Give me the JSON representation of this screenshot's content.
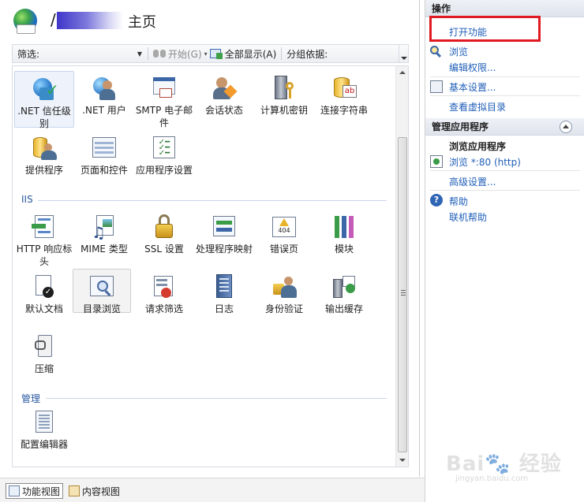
{
  "header": {
    "title_prefix": "/",
    "title": "主页"
  },
  "toolbar": {
    "filter_label": "筛选:",
    "filter_value": "",
    "start_label": "开始(G)",
    "show_all_label": "全部显示(A)",
    "group_by_label": "分组依据:"
  },
  "features": {
    "top": [
      {
        "label": ".NET 信任级别",
        "icon": "dotnet-trust-icon"
      },
      {
        "label": ".NET 用户",
        "icon": "dotnet-users-icon"
      },
      {
        "label": "SMTP 电子邮件",
        "icon": "smtp-email-icon"
      },
      {
        "label": "会话状态",
        "icon": "session-state-icon"
      },
      {
        "label": "计算机密钥",
        "icon": "machine-key-icon"
      },
      {
        "label": "连接字符串",
        "icon": "connection-strings-icon"
      },
      {
        "label": "提供程序",
        "icon": "providers-icon"
      },
      {
        "label": "页面和控件",
        "icon": "pages-controls-icon"
      },
      {
        "label": "应用程序设置",
        "icon": "app-settings-icon"
      }
    ],
    "iis_section": "IIS",
    "iis": [
      {
        "label": "HTTP 响应标头",
        "icon": "http-headers-icon"
      },
      {
        "label": "MIME 类型",
        "icon": "mime-types-icon"
      },
      {
        "label": "SSL 设置",
        "icon": "ssl-lock-icon"
      },
      {
        "label": "处理程序映射",
        "icon": "handler-mappings-icon"
      },
      {
        "label": "错误页",
        "icon": "error-pages-icon"
      },
      {
        "label": "模块",
        "icon": "modules-icon"
      },
      {
        "label": "默认文档",
        "icon": "default-document-icon"
      },
      {
        "label": "目录浏览",
        "icon": "directory-browsing-icon"
      },
      {
        "label": "请求筛选",
        "icon": "request-filtering-icon"
      },
      {
        "label": "日志",
        "icon": "logging-icon"
      },
      {
        "label": "身份验证",
        "icon": "authentication-icon"
      },
      {
        "label": "输出缓存",
        "icon": "output-caching-icon"
      },
      {
        "label": "压缩",
        "icon": "compression-icon"
      }
    ],
    "manage_section": "管理",
    "manage": [
      {
        "label": "配置编辑器",
        "icon": "config-editor-icon"
      }
    ]
  },
  "bottom_tabs": {
    "features_view": "功能视图",
    "content_view": "内容视图"
  },
  "actions": {
    "header": "操作",
    "open_feature": "打开功能",
    "browse": "浏览",
    "edit_permissions": "编辑权限...",
    "basic_settings": "基本设置...",
    "view_virtual_dirs": "查看虚拟目录",
    "manage_app_header": "管理应用程序",
    "browse_app_label": "浏览应用程序",
    "browse_http": "浏览 *:80 (http)",
    "advanced_settings": "高级设置...",
    "help": "帮助",
    "online_help": "联机帮助"
  },
  "colors": {
    "link": "#1f5eb8",
    "highlight_box": "#e01a22",
    "section": "#2a5aa0"
  },
  "watermark": {
    "brand": "Baidu 经验",
    "url": "jingyan.baidu.com"
  }
}
